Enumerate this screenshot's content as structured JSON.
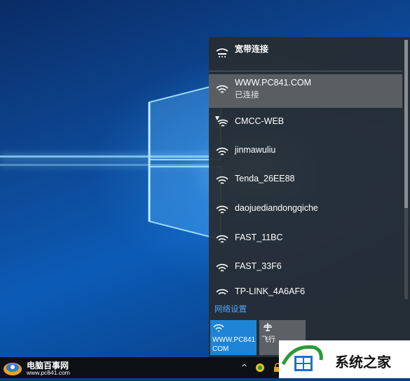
{
  "broadband": {
    "label": "宽带连接"
  },
  "connected_network": {
    "ssid": "WWW.PC841.COM",
    "status": "已连接"
  },
  "networks": [
    {
      "ssid": "CMCC-WEB",
      "secured": false
    },
    {
      "ssid": "jinmawuliu",
      "secured": true
    },
    {
      "ssid": "Tenda_26EE88",
      "secured": true
    },
    {
      "ssid": "daojuediandongqiche",
      "secured": true
    },
    {
      "ssid": "FAST_11BC",
      "secured": true
    },
    {
      "ssid": "FAST_33F6",
      "secured": true
    },
    {
      "ssid": "TP-LINK_4A6AF6",
      "secured": true
    }
  ],
  "network_settings_link": "网络设置",
  "tiles": {
    "wifi": {
      "label": "WWW.PC841.\nCOM",
      "icon": "wifi-icon"
    },
    "airplane": {
      "label": "飞行",
      "icon": "airplane-icon"
    }
  },
  "taskbar": {
    "brand_name": "电脑百事网",
    "brand_url": "www.pc841.com",
    "tray_chevron": "^"
  },
  "watermark": {
    "text": "系统之家"
  },
  "colors": {
    "accent": "#1e84d6",
    "flyout_bg": "#282c30",
    "link": "#4ea6ff"
  }
}
